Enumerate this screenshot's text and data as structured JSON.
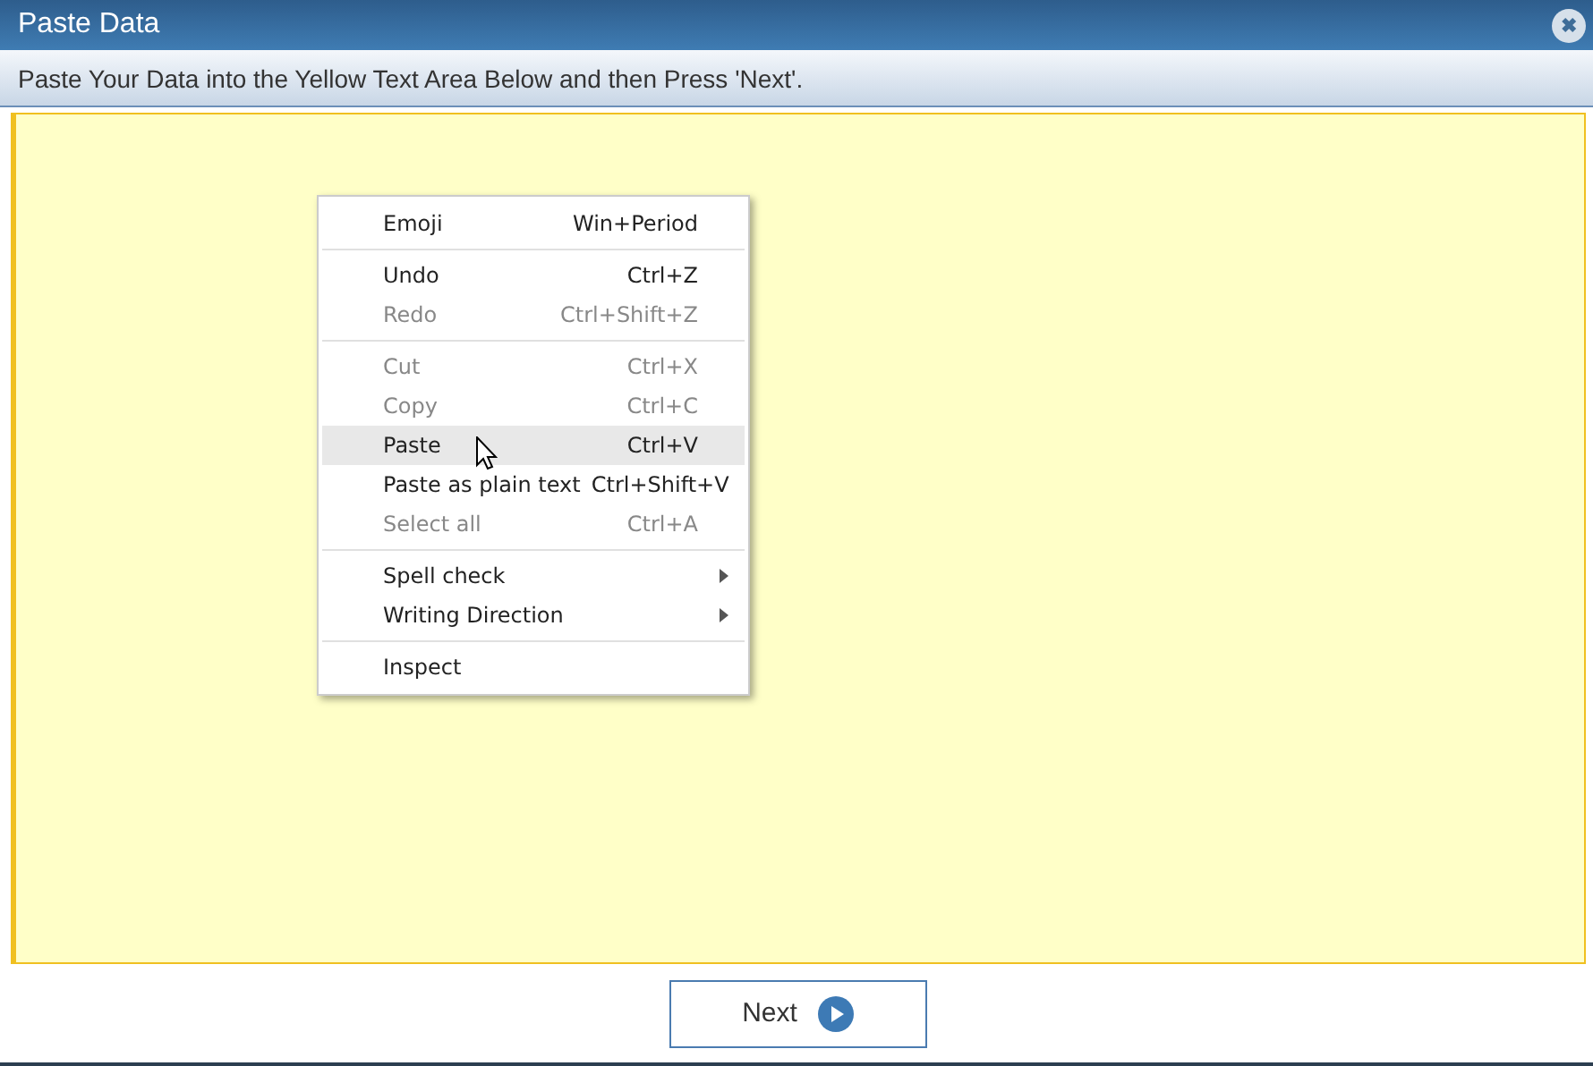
{
  "window": {
    "title": "Paste Data",
    "close_icon": "✖"
  },
  "instruction": "Paste Your Data into the Yellow Text Area Below and then Press 'Next'.",
  "context_menu": {
    "groups": [
      [
        {
          "label": "Emoji",
          "shortcut": "Win+Period",
          "disabled": false,
          "selected": false,
          "submenu": false
        }
      ],
      [
        {
          "label": "Undo",
          "shortcut": "Ctrl+Z",
          "disabled": false,
          "selected": false,
          "submenu": false
        },
        {
          "label": "Redo",
          "shortcut": "Ctrl+Shift+Z",
          "disabled": true,
          "selected": false,
          "submenu": false
        }
      ],
      [
        {
          "label": "Cut",
          "shortcut": "Ctrl+X",
          "disabled": true,
          "selected": false,
          "submenu": false
        },
        {
          "label": "Copy",
          "shortcut": "Ctrl+C",
          "disabled": true,
          "selected": false,
          "submenu": false
        },
        {
          "label": "Paste",
          "shortcut": "Ctrl+V",
          "disabled": false,
          "selected": true,
          "submenu": false
        },
        {
          "label": "Paste as plain text",
          "shortcut": "Ctrl+Shift+V",
          "disabled": false,
          "selected": false,
          "submenu": false
        },
        {
          "label": "Select all",
          "shortcut": "Ctrl+A",
          "disabled": true,
          "selected": false,
          "submenu": false
        }
      ],
      [
        {
          "label": "Spell check",
          "disabled": false,
          "selected": false,
          "submenu": true
        },
        {
          "label": "Writing Direction",
          "disabled": false,
          "selected": false,
          "submenu": true
        }
      ],
      [
        {
          "label": "Inspect",
          "disabled": false,
          "selected": false,
          "submenu": false
        }
      ]
    ]
  },
  "next_button": {
    "label": "Next"
  }
}
